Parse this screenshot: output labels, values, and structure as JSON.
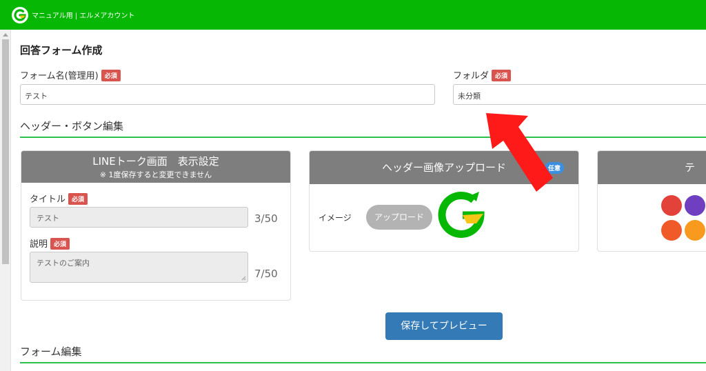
{
  "header": {
    "app_title": "マニュアル用 | エルメアカウント"
  },
  "page": {
    "title": "回答フォーム作成"
  },
  "form": {
    "name_label": "フォーム名(管理用)",
    "name_badge": "必須",
    "name_value": "テスト",
    "folder_label": "フォルダ",
    "folder_badge": "必須",
    "folder_value": "未分類"
  },
  "sections": {
    "header_button": "ヘッダー・ボタン編集",
    "form_edit": "フォーム編集"
  },
  "line_card": {
    "title": "LINEトーク画面　表示設定",
    "subtitle": "※ 1度保存すると変更できません",
    "title_label": "タイトル",
    "title_badge": "必須",
    "title_value": "テスト",
    "title_count": "3/50",
    "desc_label": "説明",
    "desc_badge": "必須",
    "desc_value": "テストのご案内",
    "desc_count": "7/50"
  },
  "header_image_card": {
    "title": "ヘッダー画像アップロード",
    "badge": "任意",
    "image_label": "イメージ",
    "upload_label": "アップロード"
  },
  "theme_card": {
    "title": "テ",
    "colors": [
      "#e2423a",
      "#6e3fbf",
      "#f05a28",
      "#f79a1e"
    ]
  },
  "actions": {
    "save_preview_label": "保存してプレビュー"
  },
  "colors": {
    "topbar": "#06b803",
    "accent_line": "#2cc24a",
    "required_badge": "#d9534f",
    "primary_button": "#337ab7",
    "annotation_arrow": "#ff1a1a"
  }
}
